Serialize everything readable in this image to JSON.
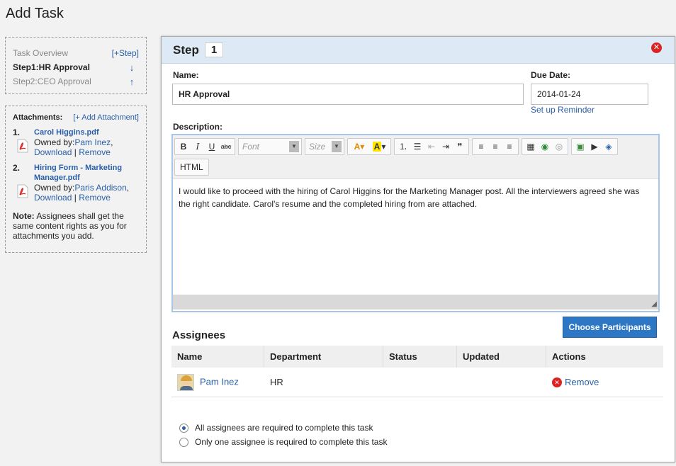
{
  "page": {
    "title": "Add Task"
  },
  "steps_nav": {
    "overview_label": "Task Overview",
    "add_step_label": "[+Step]",
    "steps": [
      {
        "label": "Step1:HR Approval",
        "arrow": "↓"
      },
      {
        "label": "Step2:CEO Approval",
        "arrow": "↑"
      }
    ]
  },
  "attachments": {
    "title": "Attachments:",
    "add_label": "[+ Add Attachment]",
    "items": [
      {
        "num": "1.",
        "filename": "Carol Higgins.pdf",
        "owned_prefix": "Owned by:",
        "owner": "Pam Inez",
        "download": "Download",
        "sep": "|",
        "remove": "Remove"
      },
      {
        "num": "2.",
        "filename": "Hiring Form - Marketing Manager.pdf",
        "owned_prefix": "Owned by:",
        "owner": "Paris Addison",
        "download": "Download",
        "sep": "|",
        "remove": "Remove"
      }
    ],
    "note_label": "Note:",
    "note_text": " Assignees shall get the same content rights as you for attachments you add."
  },
  "dialog": {
    "step_label": "Step",
    "step_number": "1",
    "name_label": "Name:",
    "name_value": "HR Approval",
    "due_label": "Due Date:",
    "due_value": "2014-01-24",
    "reminder_link": "Set up Reminder",
    "description_label": "Description:",
    "editor": {
      "font_placeholder": "Font",
      "size_placeholder": "Size",
      "html_button": "HTML",
      "body_text": "I would like to proceed with the hiring of Carol Higgins for the Marketing Manager post. All the interviewers agreed she was the right candidate. Carol's resume and the completed hiring from are attached."
    },
    "assignees_title": "Assignees",
    "choose_button": "Choose Participants",
    "table": {
      "headers": [
        "Name",
        "Department",
        "Status",
        "Updated",
        "Actions"
      ],
      "rows": [
        {
          "name": "Pam Inez",
          "department": "HR",
          "status": "",
          "updated": "",
          "action": "Remove"
        }
      ]
    },
    "completion_options": [
      {
        "label": "All assignees are required to complete this task",
        "selected": true
      },
      {
        "label": "Only one assignee is required to complete this task",
        "selected": false
      }
    ]
  },
  "colors": {
    "accent": "#2d77c5",
    "link": "#2a5fa8",
    "header_bg": "#dde9f5",
    "danger": "#dd2222"
  }
}
